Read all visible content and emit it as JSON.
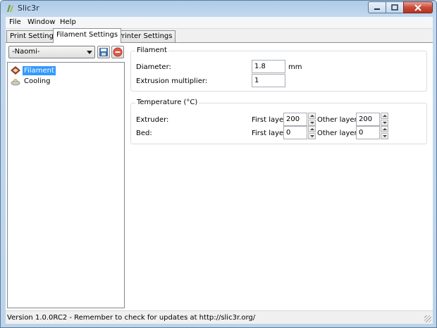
{
  "window": {
    "title": "Slic3r"
  },
  "menu": {
    "items": [
      "File",
      "Window",
      "Help"
    ]
  },
  "tabs": [
    {
      "label": "Print Settings",
      "active": false
    },
    {
      "label": "Filament Settings",
      "active": true
    },
    {
      "label": "Printer Settings",
      "active": false
    }
  ],
  "preset": {
    "selected": "-Naomi-",
    "save_icon": "save-icon",
    "delete_icon": "delete-icon"
  },
  "tree": {
    "items": [
      {
        "label": "Filament",
        "icon": "spool-icon",
        "selected": true
      },
      {
        "label": "Cooling",
        "icon": "fan-icon",
        "selected": false
      }
    ]
  },
  "filament": {
    "title": "Filament",
    "diameter_label": "Diameter:",
    "diameter_value": "1.8",
    "diameter_unit": "mm",
    "extrusion_label": "Extrusion multiplier:",
    "extrusion_value": "1"
  },
  "temperature": {
    "title": "Temperature (°C)",
    "extruder_label": "Extruder:",
    "bed_label": "Bed:",
    "first_layer_label": "First layer:",
    "other_layers_label": "Other layers:",
    "extruder_first": "200",
    "extruder_other": "200",
    "bed_first": "0",
    "bed_other": "0"
  },
  "status": {
    "text": "Version 1.0.0RC2 - Remember to check for updates at http://slic3r.org/"
  },
  "colors": {
    "selection": "#3399ff",
    "titlebar": "#bcd3ea",
    "close_button": "#c74c3a"
  }
}
